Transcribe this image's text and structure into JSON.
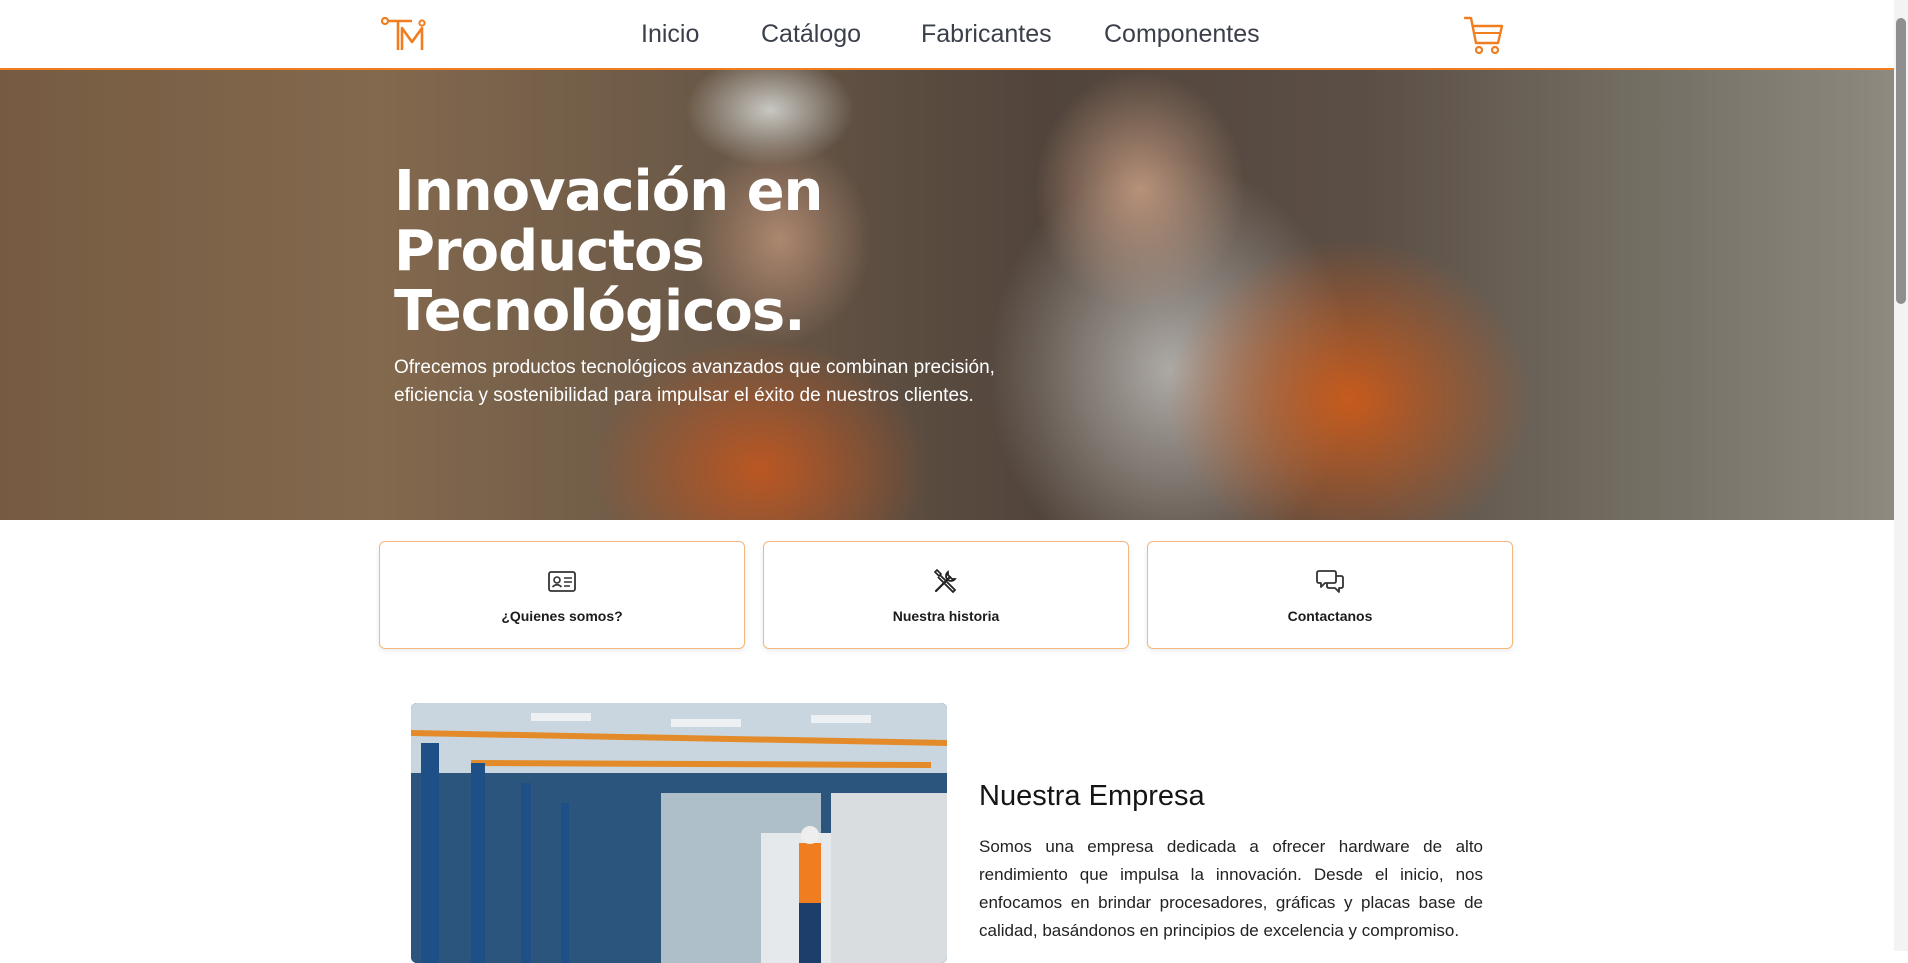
{
  "nav": {
    "items": [
      "Inicio",
      "Catálogo",
      "Fabricantes",
      "Componentes"
    ]
  },
  "hero": {
    "title": "Innovación en Productos Tecnológicos.",
    "subtitle": "Ofrecemos productos tecnológicos avanzados que combinan precisión, eficiencia y sostenibilidad para impulsar el éxito de nuestros clientes."
  },
  "cards": [
    {
      "label": "¿Quienes somos?",
      "icon": "id-card-icon"
    },
    {
      "label": "Nuestra historia",
      "icon": "tools-icon"
    },
    {
      "label": "Contactanos",
      "icon": "chat-icon"
    }
  ],
  "about": {
    "title": "Nuestra Empresa",
    "text": "Somos una empresa dedicada a ofrecer hardware de alto rendimiento que impulsa la innovación. Desde el inicio, nos enfocamos en brindar procesadores, gráficas y placas base de calidad, basándonos en principios de excelencia y compromiso."
  },
  "colors": {
    "accent": "#f07d1f",
    "card_border": "#f3b87e"
  }
}
